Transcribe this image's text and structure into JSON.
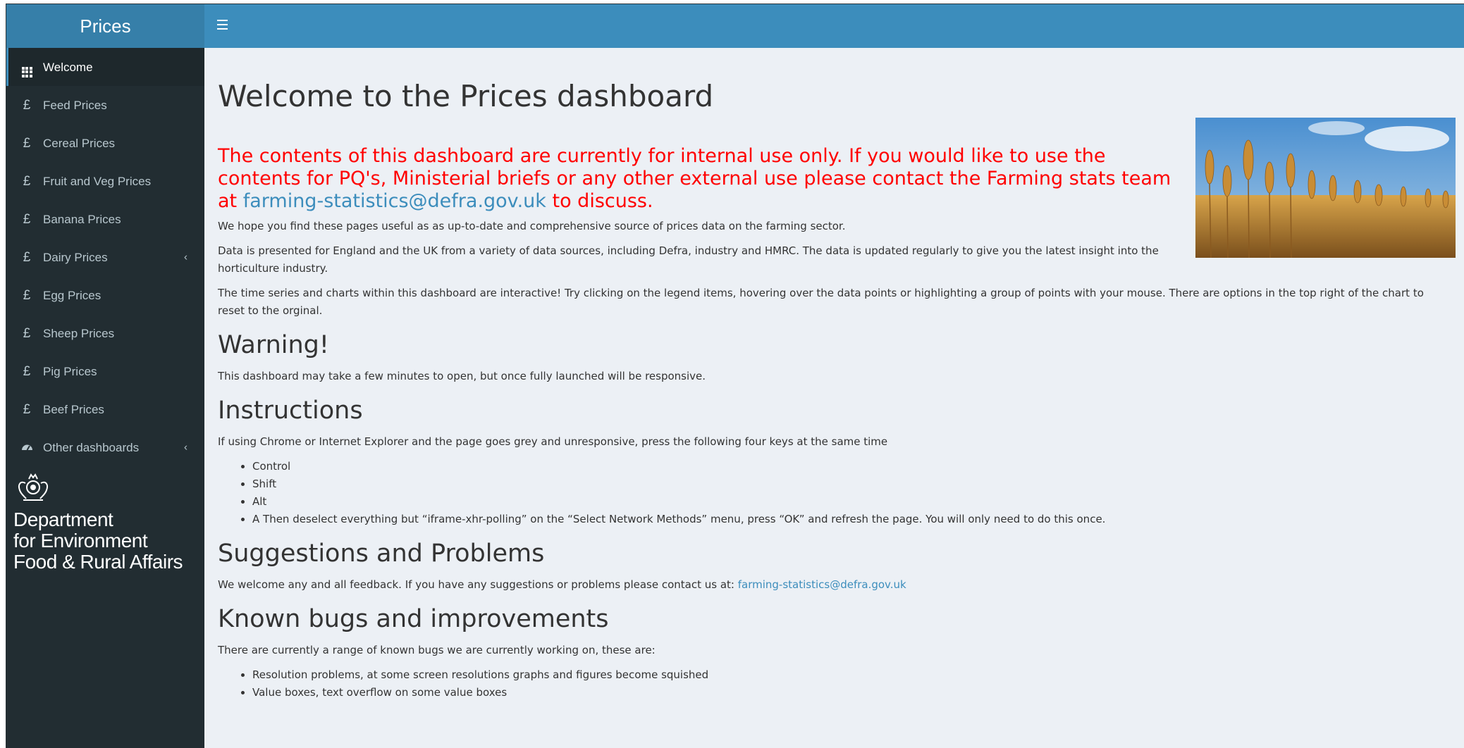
{
  "app": {
    "title": "Prices"
  },
  "sidebar": {
    "items": [
      {
        "label": "Welcome",
        "icon": "grid-icon",
        "active": true
      },
      {
        "label": "Feed Prices",
        "icon": "pound-icon"
      },
      {
        "label": "Cereal Prices",
        "icon": "pound-icon"
      },
      {
        "label": "Fruit and Veg Prices",
        "icon": "pound-icon"
      },
      {
        "label": "Banana Prices",
        "icon": "pound-icon"
      },
      {
        "label": "Dairy Prices",
        "icon": "pound-icon",
        "expandable": true
      },
      {
        "label": "Egg Prices",
        "icon": "pound-icon"
      },
      {
        "label": "Sheep Prices",
        "icon": "pound-icon"
      },
      {
        "label": "Pig Prices",
        "icon": "pound-icon"
      },
      {
        "label": "Beef Prices",
        "icon": "pound-icon"
      },
      {
        "label": "Other dashboards",
        "icon": "dashboard-icon",
        "expandable": true
      }
    ],
    "pound_glyph": "£",
    "chevron_glyph": "‹",
    "logo": {
      "line1": "Department",
      "line2": "for Environment",
      "line3": "Food & Rural Affairs"
    }
  },
  "main": {
    "title": "Welcome to the Prices dashboard",
    "notice": {
      "text_before": "The contents of this dashboard are currently for internal use only. If you would like to use the contents for PQ's, Ministerial briefs or any other external use please contact the Farming stats team at ",
      "email": "farming-statistics@defra.gov.uk",
      "text_after": " to discuss."
    },
    "intro_p1": "We hope you find these pages useful as as up-to-date and comprehensive source of prices data on the farming sector.",
    "intro_p2": "Data is presented for England and the UK from a variety of data sources, including Defra, industry and HMRC. The data is updated regularly to give you the latest insight into the horticulture industry.",
    "intro_p3": "The time series and charts within this dashboard are interactive! Try clicking on the legend items, hovering over the data points or highlighting a group of points with your mouse. There are options in the top right of the chart to reset to the orginal.",
    "warning": {
      "heading": "Warning!",
      "text": "This dashboard may take a few minutes to open, but once fully launched will be responsive."
    },
    "instructions": {
      "heading": "Instructions",
      "text": "If using Chrome or Internet Explorer and the page goes grey and unresponsive, press the following four keys at the same time",
      "items": [
        "Control",
        "Shift",
        "Alt",
        "A Then deselect everything but “iframe-xhr-polling” on the “Select Network Methods” menu, press “OK” and refresh the page. You will only need to do this once."
      ]
    },
    "suggestions": {
      "heading": "Suggestions and Problems",
      "text": "We welcome any and all feedback. If you have any suggestions or problems please contact us at: ",
      "email": "farming-statistics@defra.gov.uk"
    },
    "bugs": {
      "heading": "Known bugs and improvements",
      "text": "There are currently a range of known bugs we are currently working on, these are:",
      "items": [
        "Resolution problems, at some screen resolutions graphs and figures become squished",
        "Value boxes, text overflow on some value boxes"
      ]
    }
  },
  "colors": {
    "header": "#3c8dbc",
    "logo_bg": "#367fa9",
    "sidebar_bg": "#222d32",
    "content_bg": "#ecf0f5",
    "notice": "#ff0000",
    "link": "#3c8dbc"
  }
}
